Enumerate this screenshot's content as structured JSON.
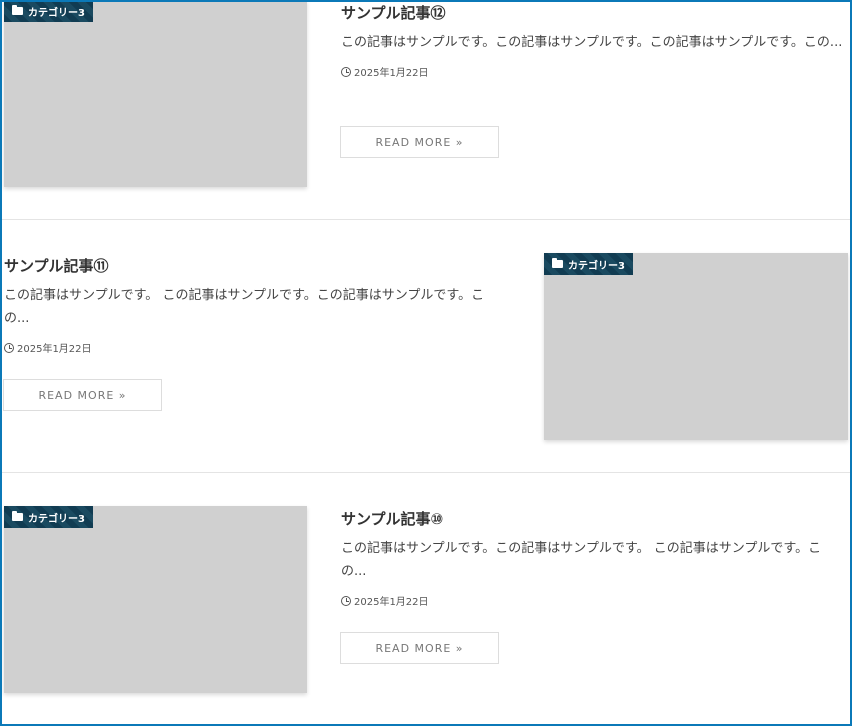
{
  "posts": [
    {
      "category": "カテゴリー3",
      "title": "サンプル記事⑫",
      "excerpt": "この記事はサンプルです。この記事はサンプルです。この記事はサンプルです。この...",
      "date": "2025年1月22日",
      "button": "READ MORE »"
    },
    {
      "category": "カテゴリー3",
      "title": "サンプル記事⑪",
      "excerpt": "この記事はサンプルです。 この記事はサンプルです。この記事はサンプルです。この...",
      "date": "2025年1月22日",
      "button": "READ MORE »"
    },
    {
      "category": "カテゴリー3",
      "title": "サンプル記事⑩",
      "excerpt": "この記事はサンプルです。この記事はサンプルです。 この記事はサンプルです。この...",
      "date": "2025年1月22日",
      "button": "READ MORE »"
    }
  ],
  "colors": {
    "frame": "#0b79b8",
    "category_bg": "#113c52",
    "thumb": "#d0d0d0"
  }
}
